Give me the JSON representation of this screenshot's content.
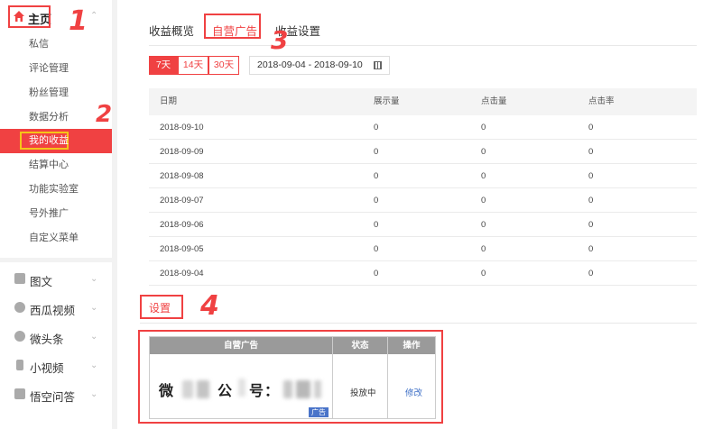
{
  "sidebar": {
    "home_label": "主页",
    "sub_items": [
      {
        "label": "私信"
      },
      {
        "label": "评论管理"
      },
      {
        "label": "粉丝管理"
      },
      {
        "label": "数据分析"
      },
      {
        "label": "我的收益"
      },
      {
        "label": "结算中心"
      },
      {
        "label": "功能实验室"
      },
      {
        "label": "号外推广"
      },
      {
        "label": "自定义菜单"
      }
    ],
    "sections": [
      {
        "label": "图文",
        "icon": "article-icon"
      },
      {
        "label": "西瓜视频",
        "icon": "play-icon"
      },
      {
        "label": "微头条",
        "icon": "chat-icon"
      },
      {
        "label": "小视频",
        "icon": "tiktok-icon"
      },
      {
        "label": "悟空问答",
        "icon": "qa-icon"
      }
    ]
  },
  "tabs": [
    {
      "label": "收益概览"
    },
    {
      "label": "自营广告"
    },
    {
      "label": "收益设置"
    }
  ],
  "range_buttons": [
    {
      "label": "7天"
    },
    {
      "label": "14天"
    },
    {
      "label": "30天"
    }
  ],
  "date_range": "2018-09-04  -  2018-09-10",
  "table": {
    "headers": [
      "日期",
      "展示量",
      "点击量",
      "点击率"
    ],
    "rows": [
      [
        "2018-09-10",
        "0",
        "0",
        "0"
      ],
      [
        "2018-09-09",
        "0",
        "0",
        "0"
      ],
      [
        "2018-09-08",
        "0",
        "0",
        "0"
      ],
      [
        "2018-09-07",
        "0",
        "0",
        "0"
      ],
      [
        "2018-09-06",
        "0",
        "0",
        "0"
      ],
      [
        "2018-09-05",
        "0",
        "0",
        "0"
      ],
      [
        "2018-09-04",
        "0",
        "0",
        "0"
      ]
    ]
  },
  "settings_label": "设置",
  "ad_table": {
    "headers": [
      "自营广告",
      "状态",
      "操作"
    ],
    "ad_text_1": "微",
    "ad_text_2": "公",
    "ad_text_3": "号：",
    "badge": "广告",
    "status": "投放中",
    "action": "修改"
  },
  "annotations": [
    "1",
    "2",
    "3",
    "4"
  ],
  "colors": {
    "accent": "#f04142",
    "highlight": "#f5c518",
    "link": "#3e6fc6"
  }
}
